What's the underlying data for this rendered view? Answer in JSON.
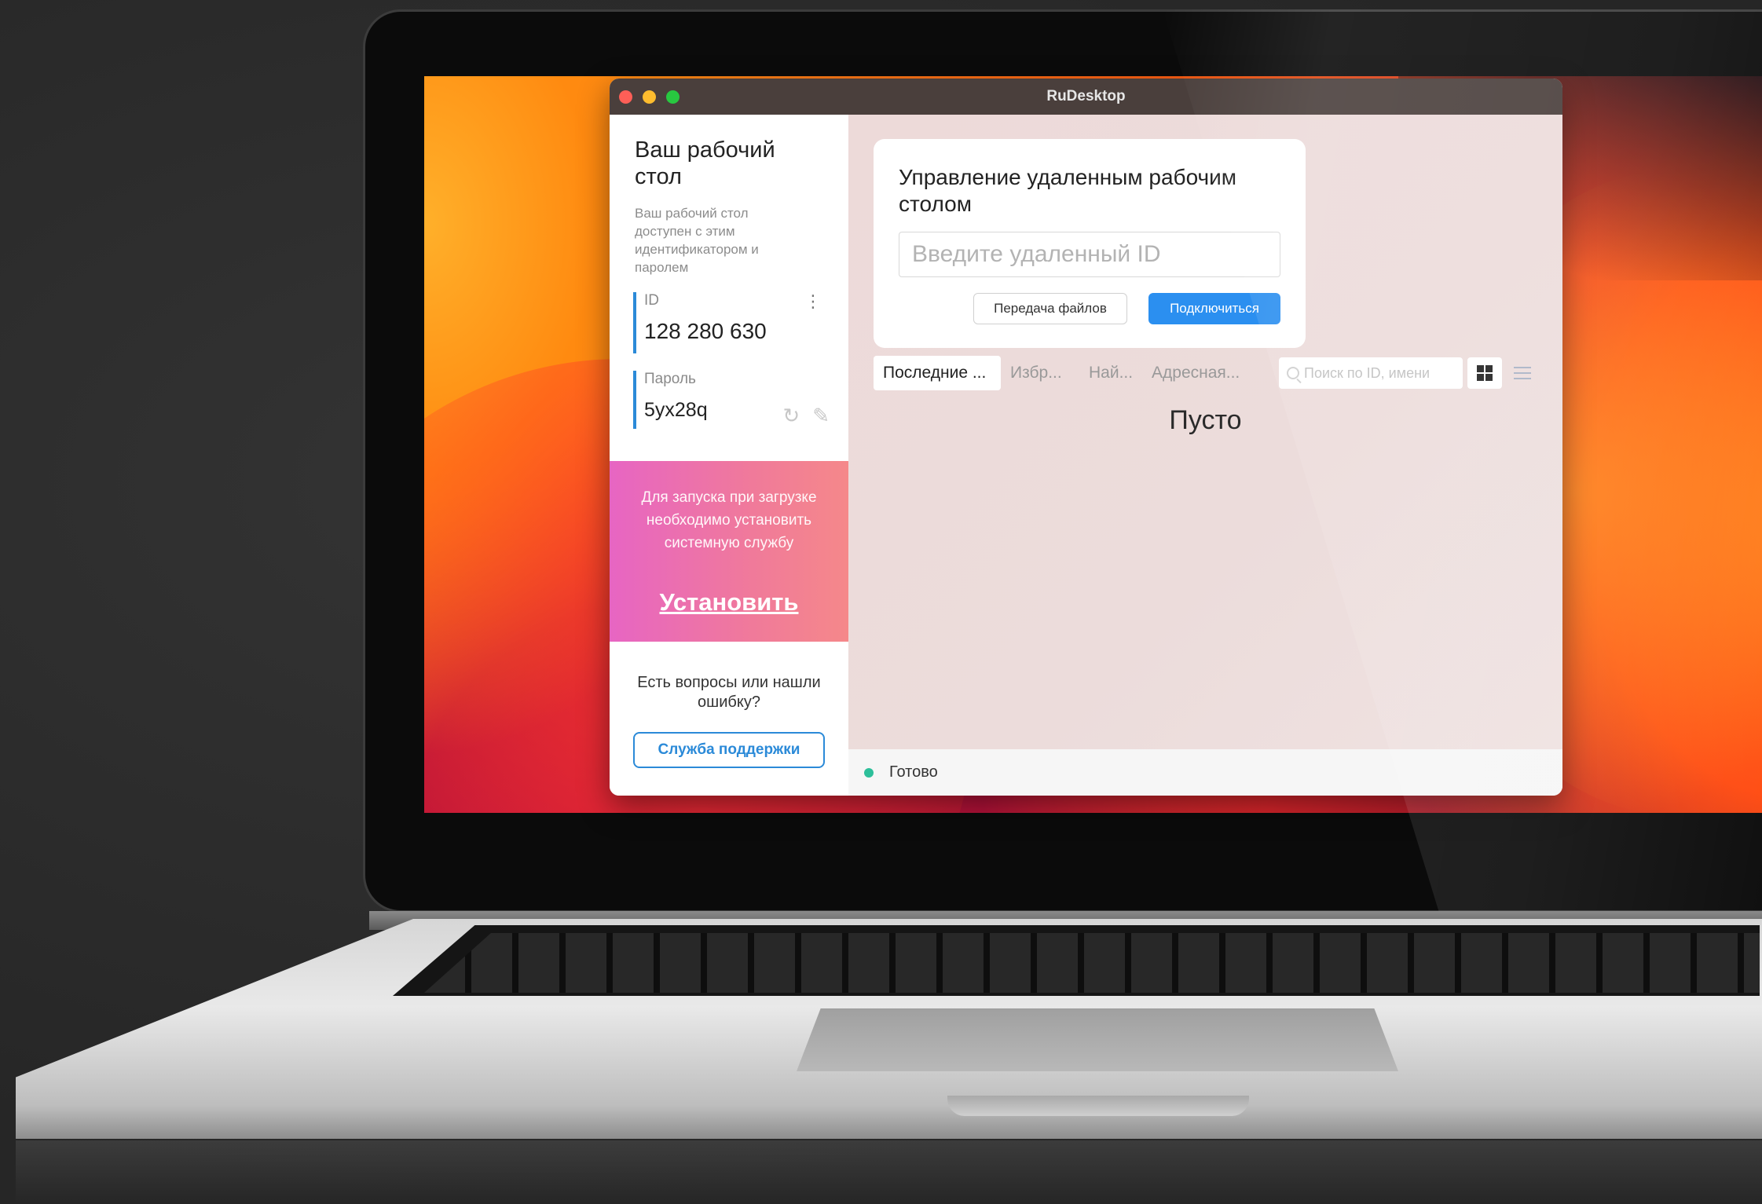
{
  "app": {
    "title": "RuDesktop"
  },
  "sidebar": {
    "title": "Ваш рабочий стол",
    "description": "Ваш рабочий стол доступен с этим идентификатором и паролем",
    "id_label": "ID",
    "id_value": "128 280 630",
    "password_label": "Пароль",
    "password_value": "5yx28q",
    "promo_text": "Для запуска при загрузке необходимо установить системную службу",
    "promo_link": "Установить",
    "support_question": "Есть вопросы или нашли ошибку?",
    "support_button": "Служба поддержки"
  },
  "remote": {
    "title": "Управление удаленным рабочим столом",
    "input_placeholder": "Введите удаленный ID",
    "input_value": "",
    "file_transfer_button": "Передача файлов",
    "connect_button": "Подключиться"
  },
  "tabs": [
    {
      "label": "Последние ...",
      "active": true
    },
    {
      "label": "Избр...",
      "active": false
    },
    {
      "label": "Най...",
      "active": false
    },
    {
      "label": "Адресная...",
      "active": false
    }
  ],
  "search": {
    "placeholder": "Поиск по ID, имени"
  },
  "content": {
    "empty_text": "Пусто"
  },
  "status": {
    "text": "Готово",
    "color": "#2dbf9a"
  },
  "icons": {
    "window_close": "close-dot",
    "window_minimize": "minimize-dot",
    "window_zoom": "zoom-dot",
    "id_menu": "more-vertical-icon",
    "refresh_password": "refresh-icon",
    "edit_password": "pencil-icon",
    "search": "search-icon",
    "grid_view": "grid-icon",
    "list_view": "list-icon"
  },
  "colors": {
    "accent": "#2b8ff0",
    "promo_start": "#e765c3",
    "promo_end": "#f5888a",
    "main_bg": "#eddad9"
  }
}
